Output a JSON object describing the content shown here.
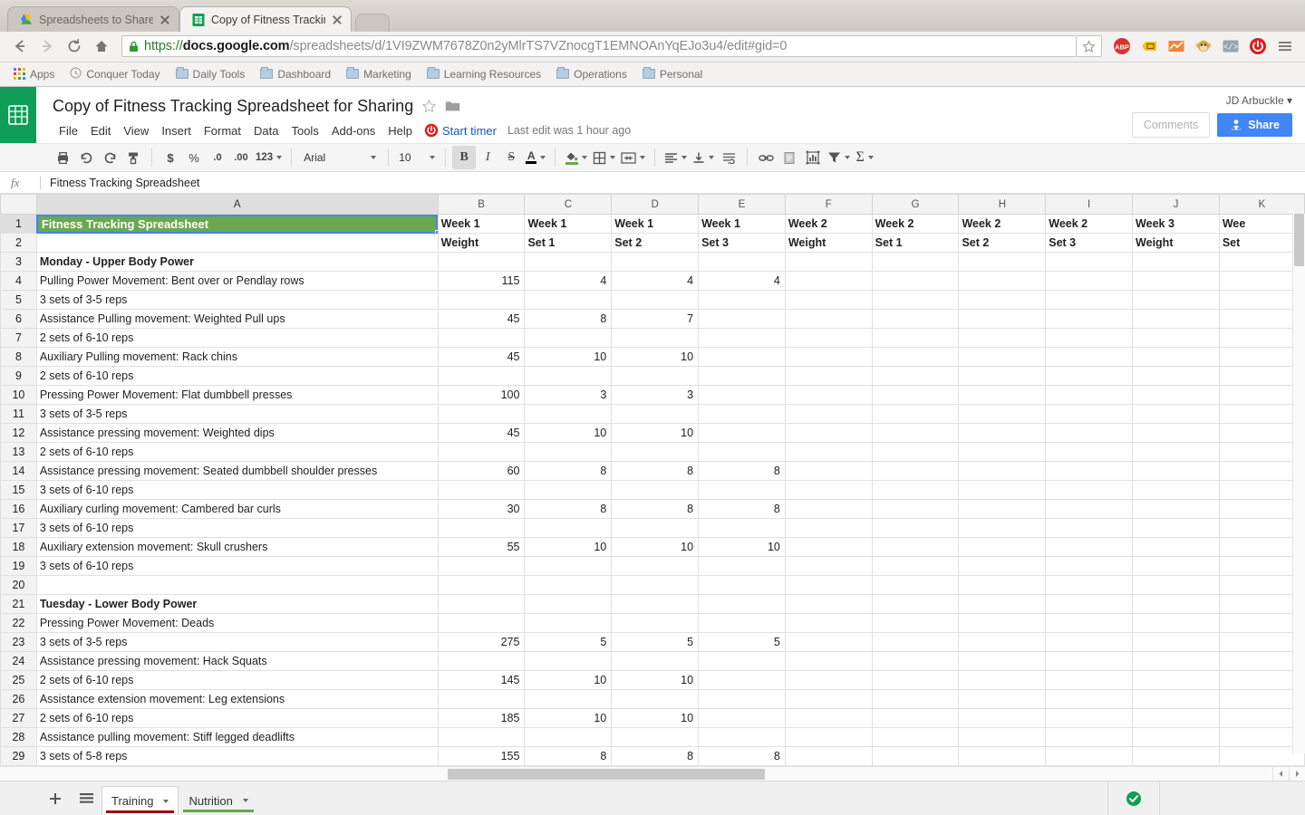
{
  "browser": {
    "tabs": [
      {
        "title": "Spreadsheets to Share for",
        "favicon": "google-drive-icon",
        "active": false
      },
      {
        "title": "Copy of Fitness Tracking S",
        "favicon": "google-sheets-icon",
        "active": true
      }
    ],
    "url": {
      "scheme": "https://",
      "host": "docs.google.com",
      "path": "/spreadsheets/d/1VI9ZWM7678Z0n2yMlrTS7VZnocgT1EMNOAnYqEJo3u4/edit#gid=0"
    },
    "bookmarks_label": "Apps",
    "bookmarks": [
      "Conquer Today",
      "Daily Tools",
      "Dashboard",
      "Marketing",
      "Learning Resources",
      "Operations",
      "Personal"
    ],
    "extensions": [
      "adblock-plus-icon",
      "tag-icon",
      "analytics-icon",
      "monkey-icon",
      "code-icon",
      "power-icon",
      "chrome-menu-icon"
    ]
  },
  "doc": {
    "title": "Copy of Fitness Tracking Spreadsheet for Sharing",
    "menus": [
      "File",
      "Edit",
      "View",
      "Insert",
      "Format",
      "Data",
      "Tools",
      "Add-ons",
      "Help"
    ],
    "timer_label": "Start timer",
    "last_edit": "Last edit was 1 hour ago",
    "account": "JD Arbuckle",
    "comments_label": "Comments",
    "share_label": "Share"
  },
  "toolbar": {
    "font": "Arial",
    "font_size": "10",
    "currency": "$",
    "percent": "%",
    "dec_less": ".0",
    "dec_more": ".00",
    "format_123": "123"
  },
  "formula_bar": {
    "fx": "fx",
    "value": "Fitness Tracking Spreadsheet"
  },
  "grid": {
    "columns": [
      "A",
      "B",
      "C",
      "D",
      "E",
      "F",
      "G",
      "H",
      "I",
      "J",
      "K"
    ],
    "selected_column": "A",
    "selected_row": 1,
    "title_cell_color": "#6aa84f",
    "rows": [
      {
        "n": 1,
        "a": "Fitness Tracking Spreadsheet",
        "style": "title",
        "cells": [
          "Week 1",
          "Week 1",
          "Week 1",
          "Week 1",
          "Week 2",
          "Week 2",
          "Week 2",
          "Week 2",
          "Week 3",
          "Wee"
        ],
        "header": true
      },
      {
        "n": 2,
        "a": "",
        "style": "",
        "cells": [
          "Weight",
          "Set 1",
          "Set 2",
          "Set 3",
          "Weight",
          "Set 1",
          "Set 2",
          "Set 3",
          "Weight",
          "Set"
        ],
        "header": true
      },
      {
        "n": 3,
        "a": "Monday - Upper Body Power",
        "style": "bold",
        "cells": [
          "",
          "",
          "",
          "",
          "",
          "",
          "",
          "",
          "",
          ""
        ]
      },
      {
        "n": 4,
        "a": "Pulling Power Movement: Bent over or Pendlay rows",
        "style": "",
        "cells": [
          "115",
          "4",
          "4",
          "4",
          "",
          "",
          "",
          "",
          "",
          ""
        ]
      },
      {
        "n": 5,
        "a": "3 sets of 3-5 reps",
        "style": "",
        "cells": [
          "",
          "",
          "",
          "",
          "",
          "",
          "",
          "",
          "",
          ""
        ]
      },
      {
        "n": 6,
        "a": "Assistance Pulling movement: Weighted Pull ups",
        "style": "",
        "cells": [
          "45",
          "8",
          "7",
          "",
          "",
          "",
          "",
          "",
          "",
          ""
        ]
      },
      {
        "n": 7,
        "a": "2 sets of 6-10 reps",
        "style": "",
        "cells": [
          "",
          "",
          "",
          "",
          "",
          "",
          "",
          "",
          "",
          ""
        ]
      },
      {
        "n": 8,
        "a": "Auxiliary Pulling movement: Rack chins",
        "style": "",
        "cells": [
          "45",
          "10",
          "10",
          "",
          "",
          "",
          "",
          "",
          "",
          ""
        ]
      },
      {
        "n": 9,
        "a": "2 sets of 6-10 reps",
        "style": "",
        "cells": [
          "",
          "",
          "",
          "",
          "",
          "",
          "",
          "",
          "",
          ""
        ]
      },
      {
        "n": 10,
        "a": "Pressing Power Movement: Flat dumbbell presses",
        "style": "",
        "cells": [
          "100",
          "3",
          "3",
          "",
          "",
          "",
          "",
          "",
          "",
          ""
        ]
      },
      {
        "n": 11,
        "a": "3 sets of 3-5 reps",
        "style": "",
        "cells": [
          "",
          "",
          "",
          "",
          "",
          "",
          "",
          "",
          "",
          ""
        ]
      },
      {
        "n": 12,
        "a": "Assistance pressing movement: Weighted dips",
        "style": "",
        "cells": [
          "45",
          "10",
          "10",
          "",
          "",
          "",
          "",
          "",
          "",
          ""
        ]
      },
      {
        "n": 13,
        "a": "2 sets of 6-10 reps",
        "style": "",
        "cells": [
          "",
          "",
          "",
          "",
          "",
          "",
          "",
          "",
          "",
          ""
        ]
      },
      {
        "n": 14,
        "a": "Assistance pressing movement: Seated dumbbell shoulder presses",
        "style": "",
        "cells": [
          "60",
          "8",
          "8",
          "8",
          "",
          "",
          "",
          "",
          "",
          ""
        ]
      },
      {
        "n": 15,
        "a": "3 sets of 6-10 reps",
        "style": "",
        "cells": [
          "",
          "",
          "",
          "",
          "",
          "",
          "",
          "",
          "",
          ""
        ]
      },
      {
        "n": 16,
        "a": "Auxiliary curling movement: Cambered bar curls",
        "style": "",
        "cells": [
          "30",
          "8",
          "8",
          "8",
          "",
          "",
          "",
          "",
          "",
          ""
        ]
      },
      {
        "n": 17,
        "a": "3 sets of 6-10 reps",
        "style": "",
        "cells": [
          "",
          "",
          "",
          "",
          "",
          "",
          "",
          "",
          "",
          ""
        ]
      },
      {
        "n": 18,
        "a": "Auxiliary extension movement: Skull crushers",
        "style": "",
        "cells": [
          "55",
          "10",
          "10",
          "10",
          "",
          "",
          "",
          "",
          "",
          ""
        ]
      },
      {
        "n": 19,
        "a": "3 sets of 6-10 reps",
        "style": "",
        "cells": [
          "",
          "",
          "",
          "",
          "",
          "",
          "",
          "",
          "",
          ""
        ]
      },
      {
        "n": 20,
        "a": "",
        "style": "",
        "cells": [
          "",
          "",
          "",
          "",
          "",
          "",
          "",
          "",
          "",
          ""
        ]
      },
      {
        "n": 21,
        "a": "Tuesday - Lower Body Power",
        "style": "bold",
        "cells": [
          "",
          "",
          "",
          "",
          "",
          "",
          "",
          "",
          "",
          ""
        ]
      },
      {
        "n": 22,
        "a": "Pressing Power Movement: Deads",
        "style": "",
        "cells": [
          "",
          "",
          "",
          "",
          "",
          "",
          "",
          "",
          "",
          ""
        ]
      },
      {
        "n": 23,
        "a": "3 sets of 3-5 reps",
        "style": "",
        "cells": [
          "275",
          "5",
          "5",
          "5",
          "",
          "",
          "",
          "",
          "",
          ""
        ]
      },
      {
        "n": 24,
        "a": "Assistance pressing movement: Hack Squats",
        "style": "",
        "cells": [
          "",
          "",
          "",
          "",
          "",
          "",
          "",
          "",
          "",
          ""
        ]
      },
      {
        "n": 25,
        "a": "2 sets of 6-10 reps",
        "style": "",
        "cells": [
          "145",
          "10",
          "10",
          "",
          "",
          "",
          "",
          "",
          "",
          ""
        ]
      },
      {
        "n": 26,
        "a": "Assistance extension movement: Leg extensions",
        "style": "",
        "cells": [
          "",
          "",
          "",
          "",
          "",
          "",
          "",
          "",
          "",
          ""
        ]
      },
      {
        "n": 27,
        "a": "2 sets of 6-10 reps",
        "style": "",
        "cells": [
          "185",
          "10",
          "10",
          "",
          "",
          "",
          "",
          "",
          "",
          ""
        ]
      },
      {
        "n": 28,
        "a": "Assistance pulling movement: Stiff legged deadlifts",
        "style": "",
        "cells": [
          "",
          "",
          "",
          "",
          "",
          "",
          "",
          "",
          "",
          ""
        ]
      },
      {
        "n": 29,
        "a": "3 sets of 5-8 reps",
        "style": "",
        "cells": [
          "155",
          "8",
          "8",
          "8",
          "",
          "",
          "",
          "",
          "",
          ""
        ]
      }
    ]
  },
  "sheet_tabs": {
    "items": [
      {
        "label": "Training",
        "color": "#990000",
        "active": true
      },
      {
        "label": "Nutrition",
        "color": "#6aa84f",
        "active": false
      }
    ],
    "add_label": "+",
    "all_sheets_label": "all-sheets-icon",
    "status": "saved-check-icon"
  }
}
